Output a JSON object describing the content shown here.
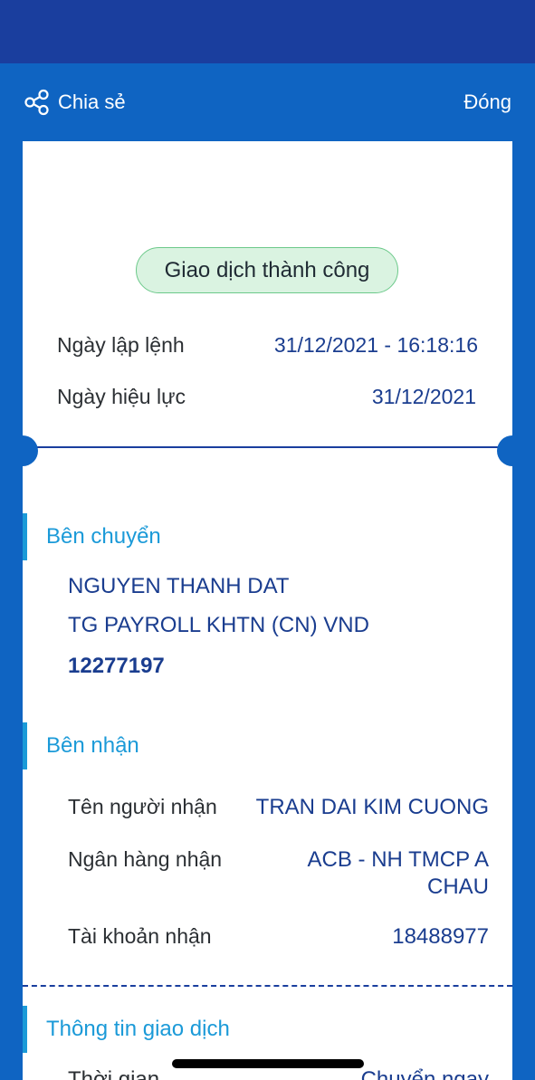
{
  "header": {
    "share_label": "Chia sẻ",
    "close_label": "Đóng"
  },
  "status": "Giao dịch thành công",
  "order_date": {
    "label": "Ngày lập lệnh",
    "value": "31/12/2021 - 16:18:16"
  },
  "effective_date": {
    "label": "Ngày hiệu lực",
    "value": "31/12/2021"
  },
  "sender": {
    "title": "Bên chuyển",
    "name": "NGUYEN THANH DAT",
    "account_name": "TG PAYROLL KHTN (CN) VND",
    "account_number": "12277197"
  },
  "receiver": {
    "title": "Bên nhận",
    "name_label": "Tên người nhận",
    "name_value": "TRAN DAI KIM CUONG",
    "bank_label": "Ngân hàng nhận",
    "bank_value_line1": "ACB - NH TMCP A",
    "bank_value_line2": "CHAU",
    "account_label": "Tài khoản nhận",
    "account_value": "18488977"
  },
  "transaction": {
    "title": "Thông tin giao dịch",
    "partial_label": "Thời gian",
    "partial_value": "Chuyển ngay"
  },
  "colors": {
    "primary": "#0f64c2",
    "status_bar": "#1a3e9e",
    "accent": "#1b9ad8",
    "success_bg": "#daf3e1",
    "value_text": "#1a3d8f"
  }
}
